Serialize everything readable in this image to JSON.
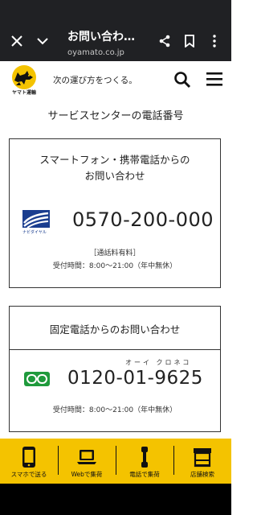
{
  "browser": {
    "title": "お問い合わ…",
    "url": "oyamato.co.jp"
  },
  "site": {
    "logo_text": "ヤマト運輸",
    "tagline": "次の運び方をつくる。"
  },
  "page": {
    "title": "サービスセンターの電話番号"
  },
  "smartphone_card": {
    "title_line1": "スマートフォン・携帯電話からの",
    "title_line2": "お問い合わせ",
    "icon_label": "ナビダイヤル",
    "phone_number": "0570-200-000",
    "fee_note": "［通話料有料］",
    "hours": "受付時間：8:00〜21:00（年中無休）"
  },
  "landline_card": {
    "title": "固定電話からのお問い合わせ",
    "reading": "オーイ クロネコ",
    "phone_number": "0120-01-9625",
    "hours": "受付時間：8:00〜21:00（年中無休）"
  },
  "bottom_nav": {
    "items": [
      {
        "label": "スマホで送る",
        "icon": "smartphone-icon"
      },
      {
        "label": "Webで集荷",
        "icon": "laptop-icon"
      },
      {
        "label": "電話で集荷",
        "icon": "phone-handset-icon"
      },
      {
        "label": "店舗検索",
        "icon": "store-icon"
      }
    ]
  },
  "colors": {
    "browser_bar": "#202124",
    "nav_yellow": "#f4c300",
    "navi_blue": "#1a3d8f",
    "freedial_green": "#1f9a3c"
  }
}
